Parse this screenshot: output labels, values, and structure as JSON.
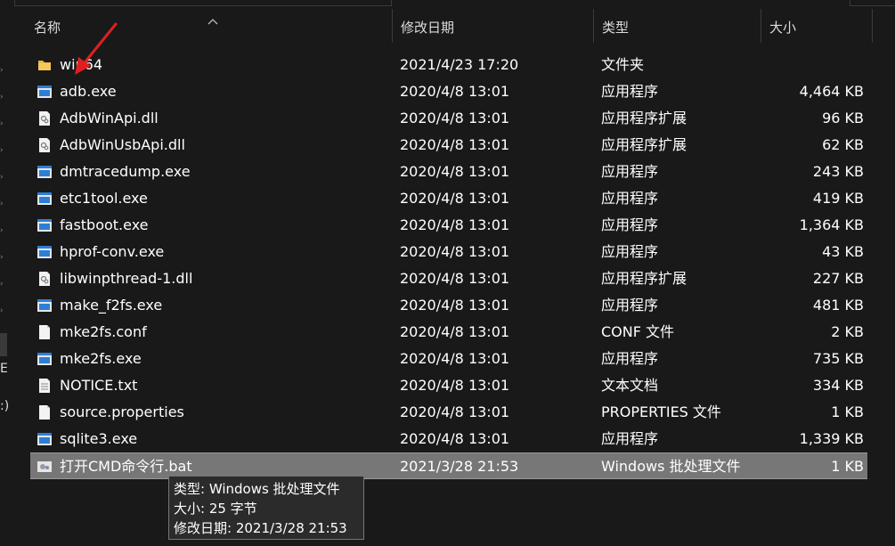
{
  "columns": {
    "name": "名称",
    "modified": "修改日期",
    "type": "类型",
    "size": "大小"
  },
  "files": [
    {
      "name": "win64",
      "modified": "2021/4/23 17:20",
      "type": "文件夹",
      "size": "",
      "icon": "folder-icon"
    },
    {
      "name": "adb.exe",
      "modified": "2020/4/8 13:01",
      "type": "应用程序",
      "size": "4,464 KB",
      "icon": "exe-icon"
    },
    {
      "name": "AdbWinApi.dll",
      "modified": "2020/4/8 13:01",
      "type": "应用程序扩展",
      "size": "96 KB",
      "icon": "dll-icon"
    },
    {
      "name": "AdbWinUsbApi.dll",
      "modified": "2020/4/8 13:01",
      "type": "应用程序扩展",
      "size": "62 KB",
      "icon": "dll-icon"
    },
    {
      "name": "dmtracedump.exe",
      "modified": "2020/4/8 13:01",
      "type": "应用程序",
      "size": "243 KB",
      "icon": "exe-icon"
    },
    {
      "name": "etc1tool.exe",
      "modified": "2020/4/8 13:01",
      "type": "应用程序",
      "size": "419 KB",
      "icon": "exe-icon"
    },
    {
      "name": "fastboot.exe",
      "modified": "2020/4/8 13:01",
      "type": "应用程序",
      "size": "1,364 KB",
      "icon": "exe-icon"
    },
    {
      "name": "hprof-conv.exe",
      "modified": "2020/4/8 13:01",
      "type": "应用程序",
      "size": "43 KB",
      "icon": "exe-icon"
    },
    {
      "name": "libwinpthread-1.dll",
      "modified": "2020/4/8 13:01",
      "type": "应用程序扩展",
      "size": "227 KB",
      "icon": "dll-icon"
    },
    {
      "name": "make_f2fs.exe",
      "modified": "2020/4/8 13:01",
      "type": "应用程序",
      "size": "481 KB",
      "icon": "exe-icon"
    },
    {
      "name": "mke2fs.conf",
      "modified": "2020/4/8 13:01",
      "type": "CONF 文件",
      "size": "2 KB",
      "icon": "file-icon"
    },
    {
      "name": "mke2fs.exe",
      "modified": "2020/4/8 13:01",
      "type": "应用程序",
      "size": "735 KB",
      "icon": "exe-icon"
    },
    {
      "name": "NOTICE.txt",
      "modified": "2020/4/8 13:01",
      "type": "文本文档",
      "size": "334 KB",
      "icon": "text-file-icon"
    },
    {
      "name": "source.properties",
      "modified": "2020/4/8 13:01",
      "type": "PROPERTIES 文件",
      "size": "1 KB",
      "icon": "file-icon"
    },
    {
      "name": "sqlite3.exe",
      "modified": "2020/4/8 13:01",
      "type": "应用程序",
      "size": "1,339 KB",
      "icon": "exe-icon"
    },
    {
      "name": "打开CMD命令行.bat",
      "modified": "2021/3/28 21:53",
      "type": "Windows 批处理文件",
      "size": "1 KB",
      "icon": "bat-icon",
      "selected": true
    }
  ],
  "tooltip": {
    "type_line": "类型: Windows 批处理文件",
    "size_line": "大小: 25 字节",
    "modified_line": "修改日期: 2021/3/28 21:53"
  },
  "nav_fragments": [
    "E",
    ":)"
  ],
  "colors": {
    "background": "#191919",
    "selected_row": "#777777",
    "folder": "#e8b84a",
    "exe": "#2b7fd6",
    "annotation_arrow": "#e02020"
  }
}
